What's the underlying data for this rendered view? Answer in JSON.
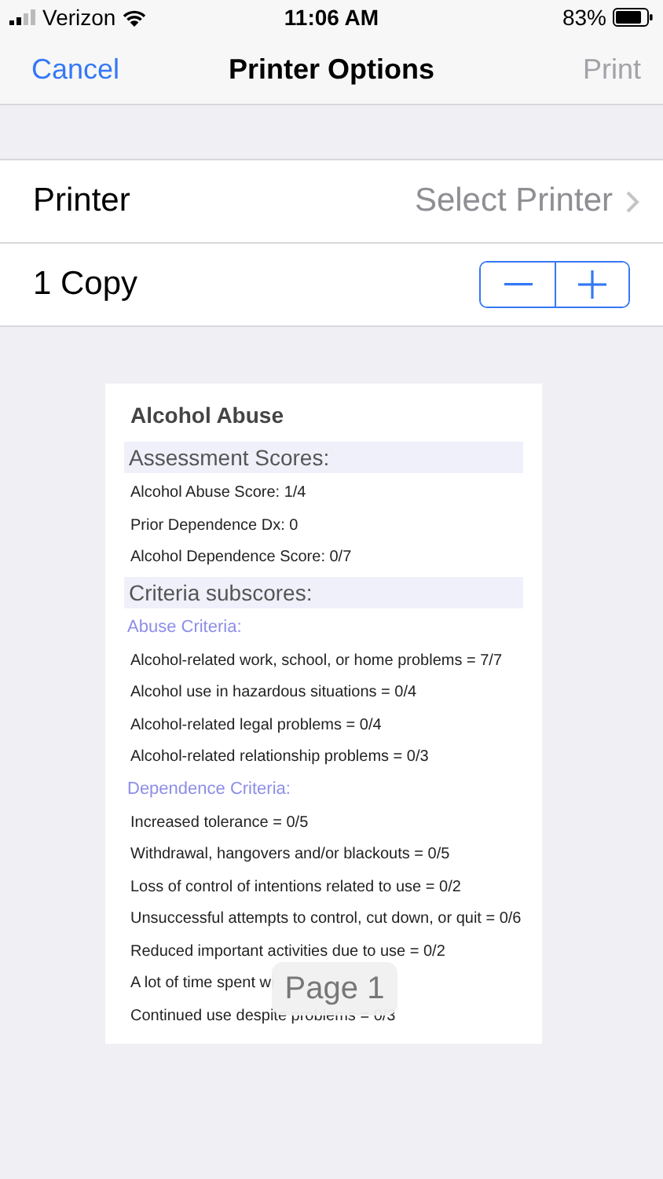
{
  "status_bar": {
    "carrier": "Verizon",
    "time": "11:06 AM",
    "battery": "83%"
  },
  "nav": {
    "cancel": "Cancel",
    "title": "Printer Options",
    "print": {
      "label": "Print",
      "disabled": true
    }
  },
  "settings": [
    {
      "kind": "link",
      "label": "Printer",
      "value": "Select Printer"
    },
    {
      "kind": "stepper",
      "label": "1 Copy"
    }
  ],
  "preview": {
    "lines": [
      {
        "kind": "title",
        "text": "Alcohol Abuse"
      },
      {
        "kind": "section",
        "text": "Assessment Scores:"
      },
      {
        "kind": "line",
        "text": "Alcohol Abuse Score: 1/4"
      },
      {
        "kind": "line",
        "text": "Prior Dependence Dx: 0"
      },
      {
        "kind": "line",
        "text": "Alcohol Dependence Score: 0/7"
      },
      {
        "kind": "section",
        "text": "Criteria subscores:"
      },
      {
        "kind": "subheading",
        "text": "Abuse Criteria:"
      },
      {
        "kind": "line",
        "text": "Alcohol-related work, school, or home problems = 7/7"
      },
      {
        "kind": "line",
        "text": "Alcohol use in hazardous situations = 0/4"
      },
      {
        "kind": "line",
        "text": "Alcohol-related legal problems = 0/4"
      },
      {
        "kind": "line",
        "text": "Alcohol-related relationship problems = 0/3"
      },
      {
        "kind": "subheading",
        "text": "Dependence Criteria:"
      },
      {
        "kind": "line",
        "text": "Increased tolerance = 0/5"
      },
      {
        "kind": "line",
        "text": "Withdrawal, hangovers and/or blackouts = 0/5"
      },
      {
        "kind": "line",
        "text": "Loss of control of intentions related to use = 0/2"
      },
      {
        "kind": "line",
        "text": "Unsuccessful attempts to control, cut down, or quit = 0/6"
      },
      {
        "kind": "line",
        "text": "Reduced important activities due to use = 0/2"
      },
      {
        "kind": "line",
        "text": "A lot of time spent wi"
      },
      {
        "kind": "line",
        "text": "Continued use despite problems = 0/3"
      }
    ],
    "page_label": "Page 1"
  }
}
